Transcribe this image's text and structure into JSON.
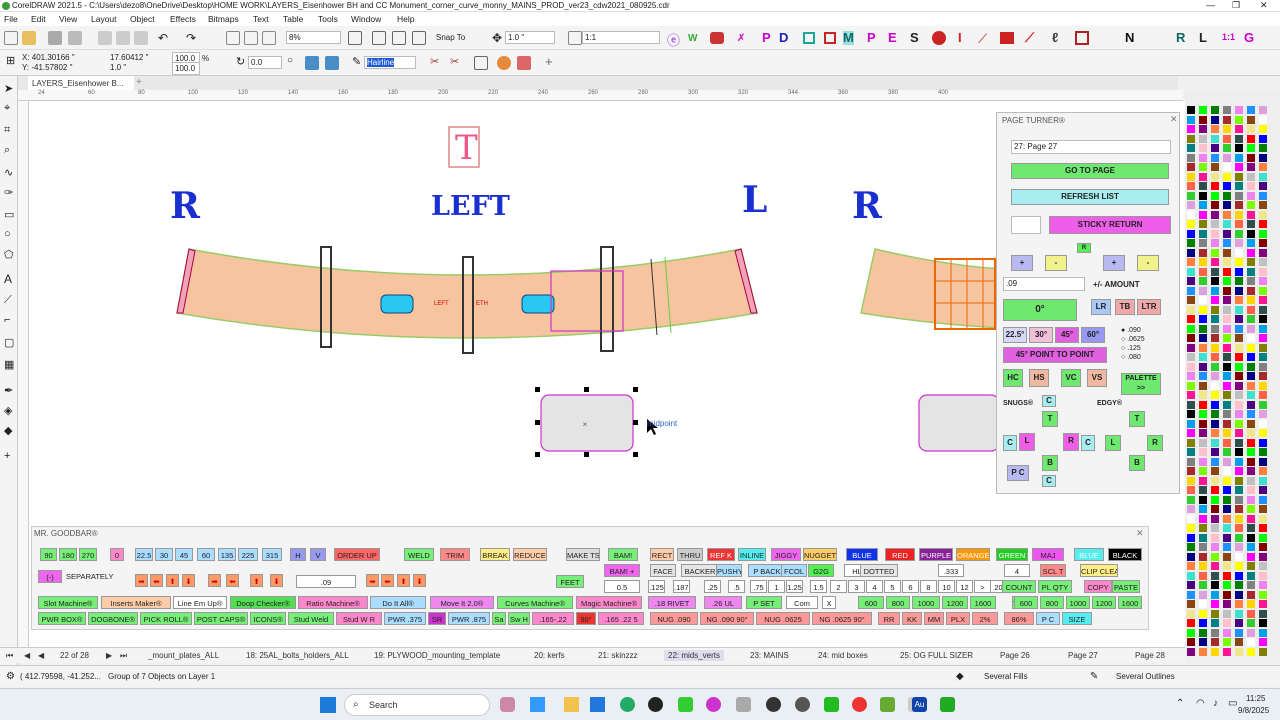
{
  "window": {
    "title": "CorelDRAW 2021.5 - C:\\Users\\dezo8\\OneDrive\\Desktop\\HOME WORK\\LAYERS_Eisenhower BH and CC Monument_corner_curve_monny_MAINS_PROD_ver23_cdw2021_080925.cdr"
  },
  "menu": [
    "File",
    "Edit",
    "View",
    "Layout",
    "Object",
    "Effects",
    "Bitmaps",
    "Text",
    "Table",
    "Tools",
    "Window",
    "Help"
  ],
  "toolbar1": {
    "zoom": "8%",
    "snap": "Snap To",
    "outline_width": "1.0 \"",
    "ratio": "1:1",
    "glyphs": [
      "P",
      "D",
      "M",
      "P",
      "E",
      "S",
      "I",
      "N",
      "R",
      "L",
      "1:1",
      "G"
    ]
  },
  "toolbar2": {
    "x": "X: 401.30166 \"",
    "y": "Y: -41.57802 \"",
    "w": "17.60412 \"",
    "h": "1.0 \"",
    "sx": "100.0",
    "sy": "100.0",
    "pct": "%",
    "angle": "0.0",
    "outline": "Hairline"
  },
  "doc_tab": "LAYERS_Eisenhower B...",
  "ruler_h": [
    "24",
    "60",
    "80",
    "100",
    "120",
    "140",
    "160",
    "180",
    "200",
    "220",
    "240",
    "260",
    "280",
    "300",
    "320",
    "344",
    "360",
    "380",
    "400",
    "420",
    "440",
    "460",
    "480"
  ],
  "canvas": {
    "t_symbol": "T",
    "r1": "R",
    "left_label": "LEFT",
    "l1": "L",
    "r2": "R",
    "curve_left_text": "LEFT",
    "curve_eth_text": "ETH",
    "midpoint": "midpoint"
  },
  "page_turner": {
    "title": "PAGE TURNER®",
    "page_select": "27: Page 27",
    "go": "GO TO PAGE",
    "refresh": "REFRESH LIST",
    "sticky": "STICKY RETURN",
    "amount": ".09",
    "amount_label": "+/- AMOUNT",
    "plus": "+",
    "minus": "-",
    "angle0": "0°",
    "a225": "22.5°",
    "a30": "30°",
    "a45": "45°",
    "a60": "60°",
    "lr": "LR",
    "tb": "TB",
    "ltr": "LTR",
    "point_to_point": "45° POINT TO POINT",
    "hc": "HC",
    "hs": "HS",
    "vc": "VC",
    "vs": "VS",
    "palette": "PALETTE >>",
    "radios": [
      ".090",
      ".0625",
      ".125",
      ".080"
    ],
    "snugs": "SNUGS®",
    "edgy": "EDGY®",
    "pc": "P C",
    "letters": {
      "C": "C",
      "T": "T",
      "L": "L",
      "R": "R",
      "B": "B"
    }
  },
  "goodbar": {
    "title": "MR. GOODBAR®",
    "row1": [
      "90",
      "180",
      "270",
      "0",
      "22.5",
      "30",
      "45",
      "60",
      "135",
      "225",
      "315",
      "H",
      "V",
      "ORDER UP",
      "WELD",
      "TRIM",
      "BREAK",
      "REDUCE",
      "MAKE TS",
      "BAM!",
      "RECT",
      "THRU",
      "REF K",
      "INLINE",
      "JIGGY",
      "NUGGET",
      "BLUE",
      "RED",
      "PURPLE",
      "ORANGE",
      "GREEN",
      "MAJ",
      "BLUE",
      "BLACK"
    ],
    "separately": "SEPARATELY",
    "minus_box": "(-)",
    "val09": ".09",
    "feet": "FEET",
    "bam_plus": "BAM! +",
    "v05": "0.5",
    "face": "FACE",
    "backer": "BACKER",
    "pushy": "PUSHY",
    "pback": "P BACK",
    "fcol": "FCOL",
    "g2g": "G2G",
    "hl": "HL",
    "dotted": "DOTTED",
    "v333": ".333",
    "v4": "4",
    "sclt": "SCL T",
    "clipclear": "CLIP CLEAR",
    "fractions": [
      ".125",
      ".1875",
      ".25",
      ".5",
      ".75",
      "1",
      "1.25",
      "1.5",
      "2",
      "3",
      "4",
      "5",
      "6",
      "8",
      "10",
      "12",
      ">",
      "20"
    ],
    "count": "COUNT",
    "plqty": "PL QTY",
    "copy": "COPY",
    "paste": "PASTE",
    "row4": [
      "Slot Machine®",
      "Inserts Maker®",
      "Line Em Up®",
      "Doop Checker®",
      "Ratio Machine®",
      "Do It All®",
      "Move It 2.0®",
      "Curves Machine®",
      "Magic Machine®",
      ".18 RIVET",
      ".26 UL",
      "P SET",
      "Com",
      "X",
      "600",
      "800",
      "1000",
      "1200",
      "1600",
      "Y",
      "600",
      "800",
      "1000",
      "1200",
      "1600"
    ],
    "row5": [
      "PWR BOX®",
      "DOGBONE®",
      "PICK ROLL®",
      "POST CAPS®",
      "ICONS®",
      "Stud Weld",
      "Stud W R",
      "PWR .375",
      "SR",
      "PWR .875",
      "Sa",
      "Sw H",
      ".165-.22",
      "90°",
      ".165 .22 5",
      "NUG .090",
      "NG .090 90°",
      "NUG .0625",
      "NG .0625 90°",
      "RR",
      "KK",
      "MM",
      "PLX",
      "2%",
      "86%",
      "P C",
      "SIZE"
    ]
  },
  "pages": {
    "counter": "22 of 28",
    "tabs": [
      "_mount_plates_ALL",
      "18: 25AL_bolts_holders_ALL",
      "19: PLYWOOD_mounting_template",
      "20: kerfs",
      "21: skinzzz",
      "22: mids_verts",
      "23: MAINS",
      "24: mid boxes",
      "25: OG FULL SIZER",
      "Page 26",
      "Page 27",
      "Page 28"
    ]
  },
  "status": {
    "coords": "( 412.79598, -41.252...",
    "object": "Group of 7 Objects on Layer 1",
    "fill": "Several Fills",
    "outline": "Several Outlines"
  },
  "taskbar": {
    "search": "Search",
    "time": "11:25",
    "date": "9/8/2025"
  },
  "palette_colors": [
    "#000000",
    "#ffffff",
    "#ff0000",
    "#00a0e9",
    "#ffff00",
    "#00ff00",
    "#ff00ff",
    "#0000ff",
    "#800000",
    "#808000",
    "#008000",
    "#800080",
    "#008080",
    "#000080",
    "#c0c0c0",
    "#808080",
    "#ff8040",
    "#ffc0cb",
    "#a52a2a",
    "#40e0d0",
    "#ee82ee",
    "#ffd700",
    "#4b0082",
    "#7cfc00",
    "#ff6347",
    "#1e90ff",
    "#ff1493",
    "#32cd32",
    "#8b4513",
    "#2f4f4f",
    "#dda0dd",
    "#f0e68c"
  ]
}
